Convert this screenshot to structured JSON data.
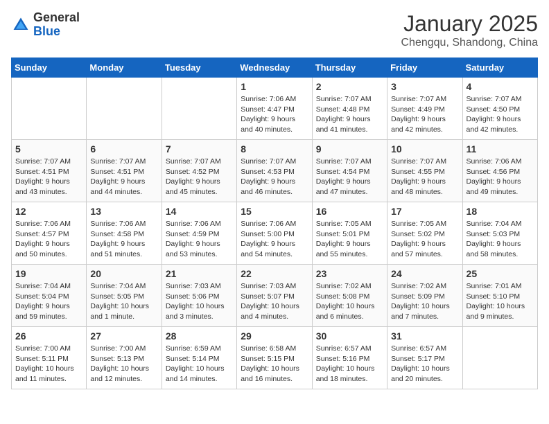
{
  "header": {
    "logo_general": "General",
    "logo_blue": "Blue",
    "month_title": "January 2025",
    "subtitle": "Chengqu, Shandong, China"
  },
  "weekdays": [
    "Sunday",
    "Monday",
    "Tuesday",
    "Wednesday",
    "Thursday",
    "Friday",
    "Saturday"
  ],
  "weeks": [
    [
      {
        "day": "",
        "info": ""
      },
      {
        "day": "",
        "info": ""
      },
      {
        "day": "",
        "info": ""
      },
      {
        "day": "1",
        "info": "Sunrise: 7:06 AM\nSunset: 4:47 PM\nDaylight: 9 hours\nand 40 minutes."
      },
      {
        "day": "2",
        "info": "Sunrise: 7:07 AM\nSunset: 4:48 PM\nDaylight: 9 hours\nand 41 minutes."
      },
      {
        "day": "3",
        "info": "Sunrise: 7:07 AM\nSunset: 4:49 PM\nDaylight: 9 hours\nand 42 minutes."
      },
      {
        "day": "4",
        "info": "Sunrise: 7:07 AM\nSunset: 4:50 PM\nDaylight: 9 hours\nand 42 minutes."
      }
    ],
    [
      {
        "day": "5",
        "info": "Sunrise: 7:07 AM\nSunset: 4:51 PM\nDaylight: 9 hours\nand 43 minutes."
      },
      {
        "day": "6",
        "info": "Sunrise: 7:07 AM\nSunset: 4:51 PM\nDaylight: 9 hours\nand 44 minutes."
      },
      {
        "day": "7",
        "info": "Sunrise: 7:07 AM\nSunset: 4:52 PM\nDaylight: 9 hours\nand 45 minutes."
      },
      {
        "day": "8",
        "info": "Sunrise: 7:07 AM\nSunset: 4:53 PM\nDaylight: 9 hours\nand 46 minutes."
      },
      {
        "day": "9",
        "info": "Sunrise: 7:07 AM\nSunset: 4:54 PM\nDaylight: 9 hours\nand 47 minutes."
      },
      {
        "day": "10",
        "info": "Sunrise: 7:07 AM\nSunset: 4:55 PM\nDaylight: 9 hours\nand 48 minutes."
      },
      {
        "day": "11",
        "info": "Sunrise: 7:06 AM\nSunset: 4:56 PM\nDaylight: 9 hours\nand 49 minutes."
      }
    ],
    [
      {
        "day": "12",
        "info": "Sunrise: 7:06 AM\nSunset: 4:57 PM\nDaylight: 9 hours\nand 50 minutes."
      },
      {
        "day": "13",
        "info": "Sunrise: 7:06 AM\nSunset: 4:58 PM\nDaylight: 9 hours\nand 51 minutes."
      },
      {
        "day": "14",
        "info": "Sunrise: 7:06 AM\nSunset: 4:59 PM\nDaylight: 9 hours\nand 53 minutes."
      },
      {
        "day": "15",
        "info": "Sunrise: 7:06 AM\nSunset: 5:00 PM\nDaylight: 9 hours\nand 54 minutes."
      },
      {
        "day": "16",
        "info": "Sunrise: 7:05 AM\nSunset: 5:01 PM\nDaylight: 9 hours\nand 55 minutes."
      },
      {
        "day": "17",
        "info": "Sunrise: 7:05 AM\nSunset: 5:02 PM\nDaylight: 9 hours\nand 57 minutes."
      },
      {
        "day": "18",
        "info": "Sunrise: 7:04 AM\nSunset: 5:03 PM\nDaylight: 9 hours\nand 58 minutes."
      }
    ],
    [
      {
        "day": "19",
        "info": "Sunrise: 7:04 AM\nSunset: 5:04 PM\nDaylight: 9 hours\nand 59 minutes."
      },
      {
        "day": "20",
        "info": "Sunrise: 7:04 AM\nSunset: 5:05 PM\nDaylight: 10 hours\nand 1 minute."
      },
      {
        "day": "21",
        "info": "Sunrise: 7:03 AM\nSunset: 5:06 PM\nDaylight: 10 hours\nand 3 minutes."
      },
      {
        "day": "22",
        "info": "Sunrise: 7:03 AM\nSunset: 5:07 PM\nDaylight: 10 hours\nand 4 minutes."
      },
      {
        "day": "23",
        "info": "Sunrise: 7:02 AM\nSunset: 5:08 PM\nDaylight: 10 hours\nand 6 minutes."
      },
      {
        "day": "24",
        "info": "Sunrise: 7:02 AM\nSunset: 5:09 PM\nDaylight: 10 hours\nand 7 minutes."
      },
      {
        "day": "25",
        "info": "Sunrise: 7:01 AM\nSunset: 5:10 PM\nDaylight: 10 hours\nand 9 minutes."
      }
    ],
    [
      {
        "day": "26",
        "info": "Sunrise: 7:00 AM\nSunset: 5:11 PM\nDaylight: 10 hours\nand 11 minutes."
      },
      {
        "day": "27",
        "info": "Sunrise: 7:00 AM\nSunset: 5:13 PM\nDaylight: 10 hours\nand 12 minutes."
      },
      {
        "day": "28",
        "info": "Sunrise: 6:59 AM\nSunset: 5:14 PM\nDaylight: 10 hours\nand 14 minutes."
      },
      {
        "day": "29",
        "info": "Sunrise: 6:58 AM\nSunset: 5:15 PM\nDaylight: 10 hours\nand 16 minutes."
      },
      {
        "day": "30",
        "info": "Sunrise: 6:57 AM\nSunset: 5:16 PM\nDaylight: 10 hours\nand 18 minutes."
      },
      {
        "day": "31",
        "info": "Sunrise: 6:57 AM\nSunset: 5:17 PM\nDaylight: 10 hours\nand 20 minutes."
      },
      {
        "day": "",
        "info": ""
      }
    ]
  ]
}
